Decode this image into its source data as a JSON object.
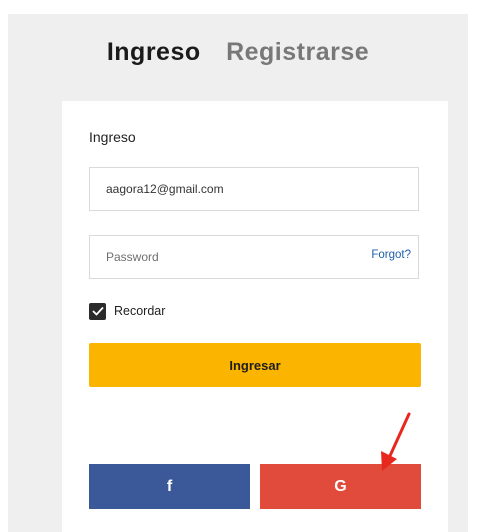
{
  "tabs": {
    "login": "Ingreso",
    "register": "Registrarse"
  },
  "form": {
    "title": "Ingreso",
    "email": {
      "value": "aagora12@gmail.com",
      "placeholder": ""
    },
    "password": {
      "value": "",
      "placeholder": "Password"
    },
    "forgot_label": "Forgot?",
    "remember": {
      "label": "Recordar",
      "checked": true
    },
    "submit_label": "Ingresar"
  },
  "social": {
    "facebook": {
      "glyph": "f",
      "color": "#3b5998"
    },
    "google": {
      "glyph": "G",
      "color": "#e04b3c"
    }
  },
  "colors": {
    "accent": "#fbb400",
    "link": "#1f5fa8",
    "annotation_arrow": "#e8281f"
  },
  "annotation": {
    "icon": "red-arrow-icon",
    "points_to": "google-login-button"
  }
}
